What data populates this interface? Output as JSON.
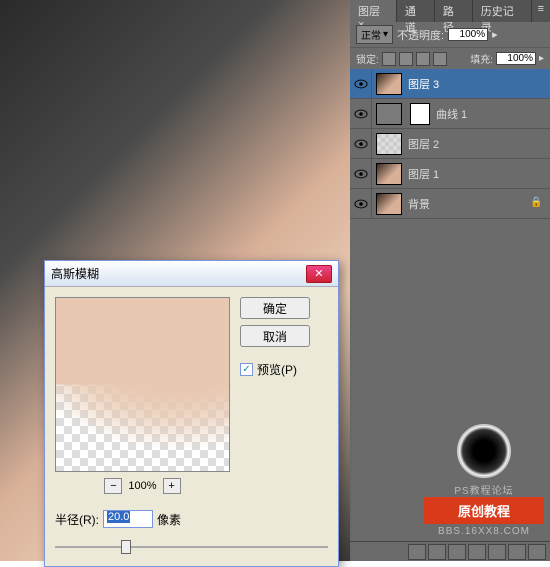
{
  "panel": {
    "tabs": [
      "图层",
      "通道",
      "路径",
      "历史记录"
    ],
    "active_tab": 0,
    "blend_mode": "正常",
    "opacity_label": "不透明度:",
    "opacity_value": "100%",
    "lock_label": "锁定:",
    "fill_label": "填充:",
    "fill_value": "100%"
  },
  "layers": [
    {
      "name": "图层 3",
      "type": "photo",
      "selected": true,
      "visible": true
    },
    {
      "name": "曲线 1",
      "type": "curves",
      "mask": true,
      "selected": false,
      "visible": true
    },
    {
      "name": "图层 2",
      "type": "checker",
      "selected": false,
      "visible": true
    },
    {
      "name": "图层 1",
      "type": "photo",
      "selected": false,
      "visible": true
    },
    {
      "name": "背景",
      "type": "photo",
      "locked": true,
      "selected": false,
      "visible": true
    }
  ],
  "dialog": {
    "title": "高斯模糊",
    "ok": "确定",
    "cancel": "取消",
    "preview_label": "预览(P)",
    "preview_checked": true,
    "zoom": "100%",
    "radius_label": "半径(R):",
    "radius_value": "20.0",
    "radius_unit": "像素"
  },
  "watermark": {
    "badge": "原创教程",
    "line1": "PS教程论坛",
    "line2": "BBS.16XX8.COM"
  }
}
